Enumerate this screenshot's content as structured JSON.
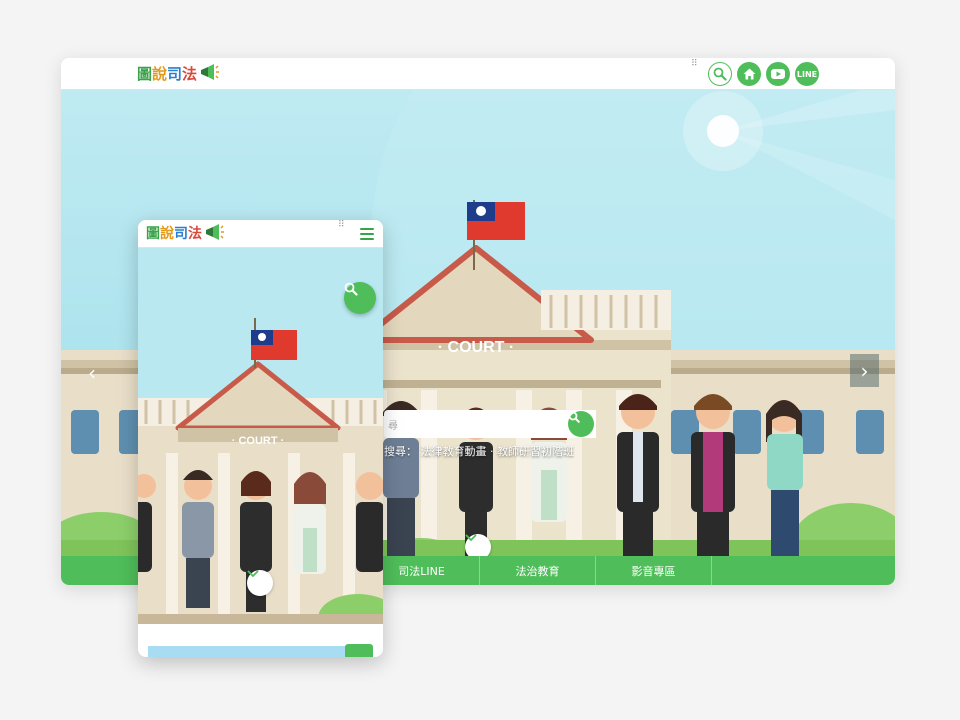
{
  "brand": {
    "logo_chars": [
      "圖",
      "說",
      "司",
      "法"
    ],
    "colors": {
      "accent": "#4fbe5a",
      "accent_dark": "#3aa34a",
      "sky": "#aee4ee",
      "wall": "#e9dfc9",
      "roof": "#c85a4a"
    }
  },
  "desktop": {
    "header": {
      "dots": "⠿",
      "icons": [
        {
          "name": "search-icon"
        },
        {
          "name": "home-icon"
        },
        {
          "name": "youtube-icon"
        },
        {
          "name": "line-icon",
          "label": "LINE"
        }
      ]
    },
    "hero": {
      "court_label": "· COURT ·",
      "search_placeholder": "尋",
      "hot_text": "搜尋：   法律教育動畫 · 教師研習初階班",
      "arrow_left": "‹",
      "arrow_right": "›"
    },
    "nav": {
      "items": [
        "司法LINE",
        "法治教育",
        "影音專區"
      ]
    }
  },
  "mobile": {
    "header": {
      "dots": "⠿"
    },
    "hero": {
      "court_label": "· COURT ·"
    }
  }
}
